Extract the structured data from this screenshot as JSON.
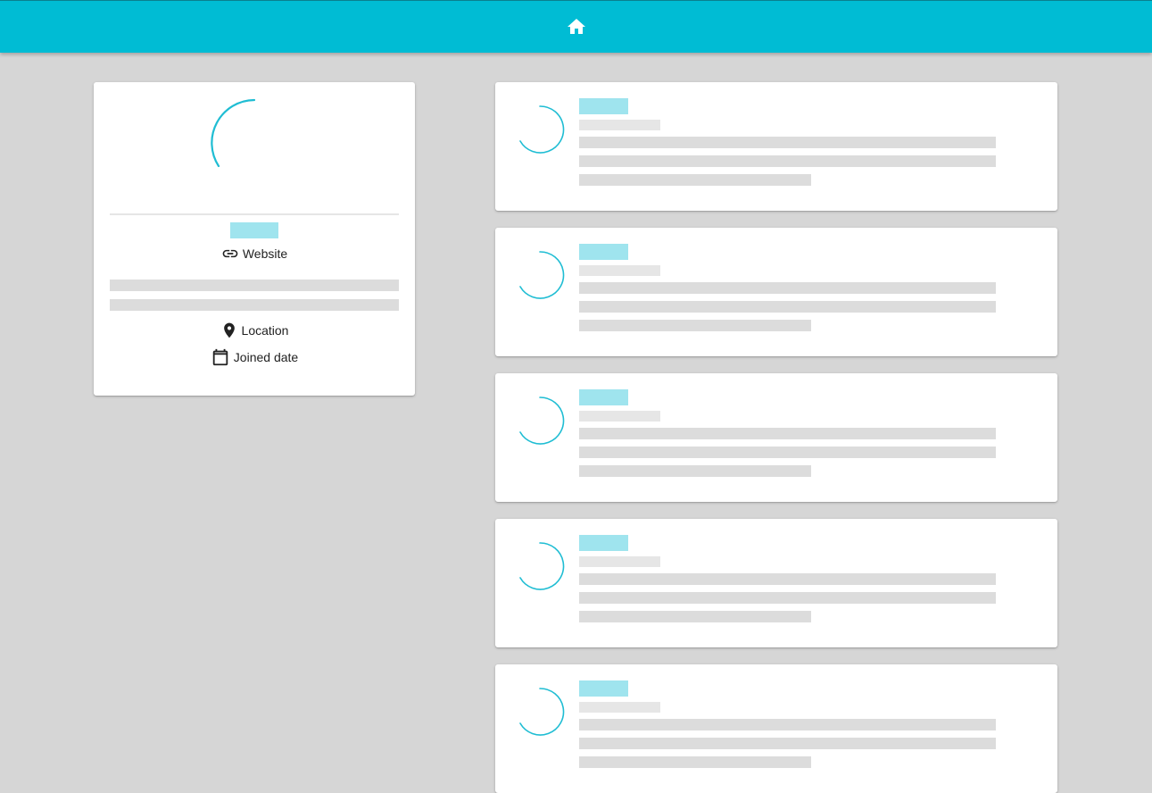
{
  "appbar": {
    "icon": "home-icon",
    "color": "#00bcd4"
  },
  "profile": {
    "website_label": "Website",
    "location_label": "Location",
    "joined_label": "Joined date",
    "icons": [
      "link-icon",
      "location-pin-icon",
      "calendar-icon"
    ]
  },
  "posts": {
    "count": 5,
    "spinner_color": "#00bcd4",
    "skeleton_accent": "#9fe4ee",
    "skeleton_gray": "#dcdcdc"
  }
}
